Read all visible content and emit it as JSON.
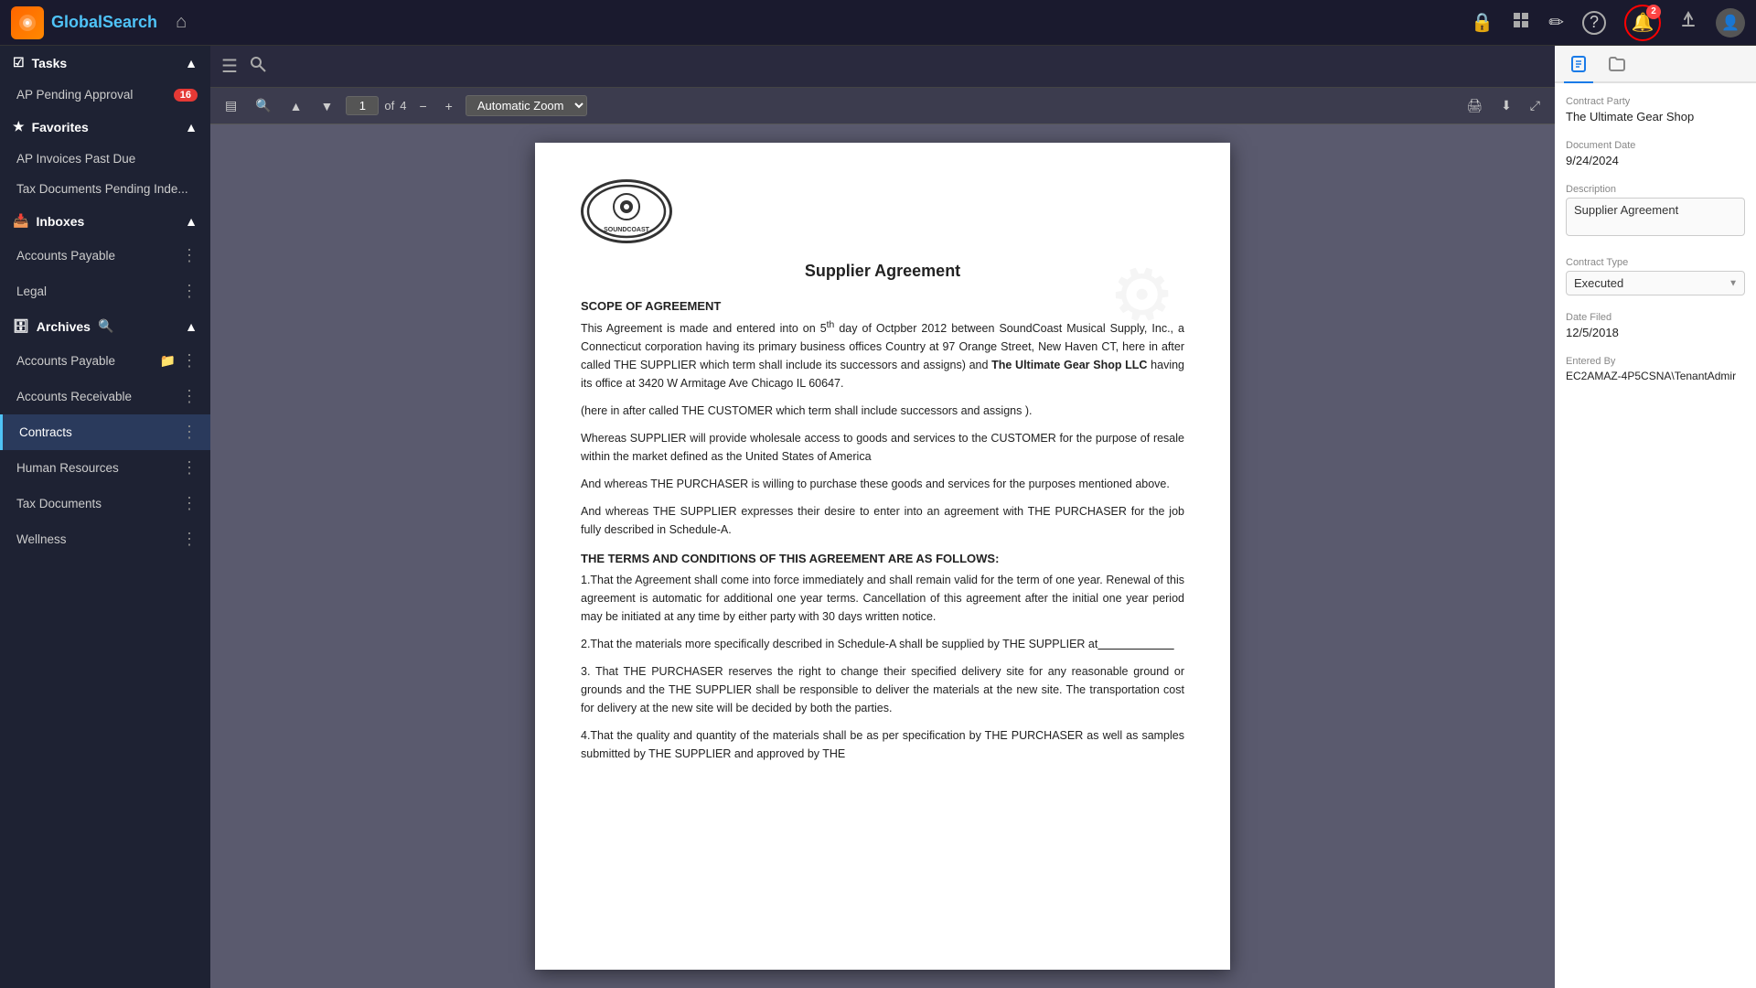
{
  "app": {
    "name": "GlobalSearch",
    "name_color": "Search"
  },
  "topnav": {
    "home_icon": "⌂",
    "icons": {
      "lock": "🔒",
      "grid": "⊞",
      "edit": "✏",
      "help": "?",
      "notification_count": "2",
      "avatar": "👤"
    }
  },
  "sidebar": {
    "tasks_label": "Tasks",
    "ap_pending_label": "AP Pending Approval",
    "ap_pending_count": "16",
    "favorites_label": "Favorites",
    "ap_invoices_label": "AP Invoices Past Due",
    "tax_docs_label": "Tax Documents Pending Inde...",
    "inboxes_label": "Inboxes",
    "inboxes_accounts_payable": "Accounts Payable",
    "inboxes_legal": "Legal",
    "archives_label": "Archives",
    "archives_accounts_payable": "Accounts Payable",
    "archives_accounts_receivable": "Accounts Receivable",
    "archives_contracts": "Contracts",
    "archives_human_resources": "Human Resources",
    "archives_tax_documents": "Tax Documents",
    "archives_wellness": "Wellness"
  },
  "pdf_toolbar": {
    "page_current": "1",
    "page_total": "4",
    "zoom_label": "Automatic Zoom"
  },
  "doc_content": {
    "title": "Supplier Agreement",
    "logo_text": "SOUNDCOAST",
    "scope_title": "SCOPE OF AGREEMENT",
    "para1": "This Agreement is made and entered into on 5th day of Octpber 2012 between SoundCoast Musical Supply, Inc., a Connecticut corporation having its primary business offices Country at 97 Orange Street, New Haven CT, here in after called THE SUPPLIER which term shall include its successors and assigns) and The Ultimate Gear Shop LLC having its office at 3420 W Armitage Ave Chicago IL 60647.",
    "para2": "(here in after called THE CUSTOMER which term shall include successors and assigns ).",
    "para3": "Whereas SUPPLIER will provide wholesale access to goods and services to the CUSTOMER for the purpose of resale within the market defined as the United States of America",
    "para4": "And whereas THE PURCHASER is willing to purchase these goods and services for the purposes mentioned above.",
    "para5": "And whereas THE SUPPLIER expresses their desire to enter into an agreement with THE PURCHASER for the job fully described in Schedule-A.",
    "terms_title": "THE TERMS AND CONDITIONS OF THIS AGREEMENT ARE AS FOLLOWS:",
    "term1": "1.That the Agreement shall come into force immediately and shall remain valid for the term of one year. Renewal of this agreement is automatic for additional one year terms. Cancellation of this agreement after the initial one year period may be initiated at any time by either party with 30 days written notice.",
    "term2": "2.That the materials more specifically described in Schedule-A shall be supplied by THE SUPPLIER at",
    "term2_underline": "_________________________",
    "term3": "3. That THE PURCHASER reserves the right to change their specified delivery site for any reasonable ground or grounds and the THE SUPPLIER shall be responsible to deliver the materials at the new site. The transportation cost for delivery at the new site will be decided by both the parties.",
    "term4": "4.That the quality and quantity of the materials shall be as per specification by THE PURCHASER as well as samples submitted by THE SUPPLIER and approved by THE"
  },
  "right_panel": {
    "contract_party_label": "Contract Party",
    "contract_party_value": "The Ultimate Gear Shop",
    "document_date_label": "Document Date",
    "document_date_value": "9/24/2024",
    "description_label": "Description",
    "description_value": "Supplier Agreement",
    "contract_type_label": "Contract Type",
    "contract_type_value": "Executed",
    "date_filed_label": "Date Filed",
    "date_filed_value": "12/5/2018",
    "entered_by_label": "Entered By",
    "entered_by_value": "EC2AMAZ-4P5CSNA\\TenantAdmir"
  }
}
